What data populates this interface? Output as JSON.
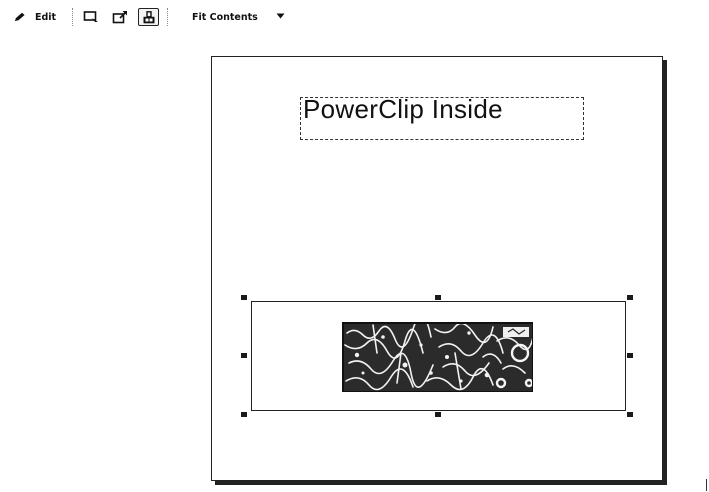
{
  "toolbar": {
    "edit_label": "Edit",
    "fit_label": "Fit Contents",
    "icons": [
      "edit-pencil-icon",
      "select-contents-icon",
      "extract-contents-icon",
      "lock-contents-icon",
      "dropdown-caret-icon"
    ]
  },
  "canvas": {
    "title_text": "PowerClip Inside",
    "image_description": "black and white textured bitmap inside PowerClip frame"
  }
}
